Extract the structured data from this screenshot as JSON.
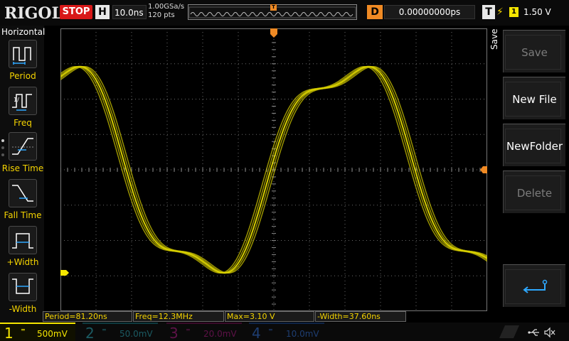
{
  "brand": "RIGOL",
  "run_state": "STOP",
  "horizontal": {
    "label": "H",
    "timebase": "10.0ns",
    "sample_rate": "1.00GSa/s",
    "memory_points": "120 pts"
  },
  "delay": {
    "label": "D",
    "value": "0.00000000ps"
  },
  "trigger": {
    "label": "T",
    "source": "1",
    "level": "1.50 V",
    "edge_icon": "rising-edge-icon"
  },
  "left_menu": {
    "title": "Horizontal",
    "items": [
      {
        "label": "Period",
        "icon": "period-measure-icon"
      },
      {
        "label": "Freq",
        "icon": "frequency-measure-icon"
      },
      {
        "label": "Rise Time",
        "icon": "rise-time-icon"
      },
      {
        "label": "Fall Time",
        "icon": "fall-time-icon"
      },
      {
        "label": "+Width",
        "icon": "positive-width-icon"
      },
      {
        "label": "-Width",
        "icon": "negative-width-icon"
      }
    ]
  },
  "right_menu": {
    "title": "Save",
    "buttons": [
      {
        "label": "Save",
        "enabled": false
      },
      {
        "label": "New File",
        "enabled": true
      },
      {
        "label": "NewFolder",
        "enabled": true
      },
      {
        "label": "Delete",
        "enabled": false
      },
      {
        "label": "",
        "icon": "return-arrow-icon",
        "enabled": true
      }
    ]
  },
  "measurements": [
    "Period=81.20ns",
    "Freq=12.3MHz",
    "Max=3.10 V",
    "-Width=37.60ns"
  ],
  "channels": [
    {
      "num": "1",
      "scale": "500mV",
      "color": "#f5e600",
      "active": true
    },
    {
      "num": "2",
      "scale": "50.0mV",
      "color": "#1ba3b5",
      "active": false
    },
    {
      "num": "3",
      "scale": "20.0mV",
      "color": "#c8128c",
      "active": false
    },
    {
      "num": "4",
      "scale": "10.0mV",
      "color": "#1e60c0",
      "active": false
    }
  ],
  "colors": {
    "ch1_trace": "#d8d000",
    "trigger_marker": "#f08a24",
    "grid": "#6a6a6a"
  },
  "status_icons": [
    "usb-icon",
    "speaker-muted-icon"
  ]
}
